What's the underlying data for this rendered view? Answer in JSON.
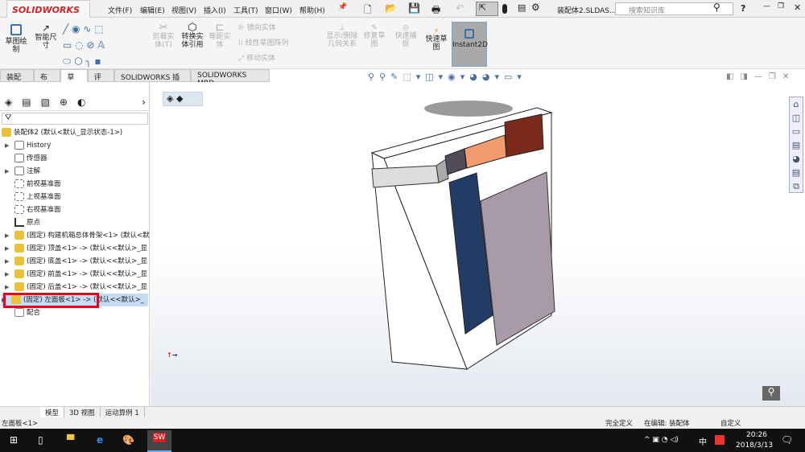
{
  "app": {
    "brand": "SOLIDWORKS",
    "document_title": "装配体2.SLDAS...",
    "search_placeholder": "搜索知识库",
    "help": "?"
  },
  "menu": [
    "文件(F)",
    "编辑(E)",
    "视图(V)",
    "插入(I)",
    "工具(T)",
    "窗口(W)",
    "帮助(H)"
  ],
  "ribbon": {
    "sketch": "草图绘制",
    "smart_dim": "智能尺寸",
    "trim": "剪裁实体(T)",
    "convert": "转换实体引用",
    "offset": "等距实体",
    "mirror": "镜向实体",
    "linear_pattern": "线性草图阵列",
    "move": "移动实体",
    "show_relations": "显示/删除几何关系",
    "repair": "修复草图",
    "quick_snap": "快速捕捉",
    "rapid_sketch": "快速草图",
    "instant2d": "Instant2D"
  },
  "tabs": [
    "装配体",
    "布局",
    "草图",
    "评估",
    "SOLIDWORKS 插件",
    "SOLIDWORKS MBD"
  ],
  "active_tab": 2,
  "tree": {
    "root": "装配体2  (默认<默认_显示状态-1>)",
    "items": [
      "History",
      "传感器",
      "注解",
      "前视基准面",
      "上视基准面",
      "右视基准面",
      "原点",
      "(固定) 构建机箱总体骨架<1> (默认<默",
      "(固定) 顶盖<1> -> (默认<<默认>_显",
      "(固定) 底盖<1> -> (默认<<默认>_显",
      "(固定) 前盖<1> -> (默认<<默认>_显",
      "(固定) 后盖<1> -> (默认<<默认>_显",
      "(固定) 左面板<1> -> (默认<<默认>_",
      "配合"
    ],
    "selected": 12
  },
  "bottom_tabs": [
    "模型",
    "3D 视图",
    "运动算例 1"
  ],
  "status": {
    "left": "左面板<1>",
    "defined": "完全定义",
    "editing": "在编辑: 装配体",
    "custom": "自定义"
  },
  "taskbar": {
    "time": "20:26",
    "date": "2018/3/13",
    "ime": "中"
  },
  "colors": {
    "highlight": "#e8001c",
    "selection": "#c5dcf2",
    "panel_blue": "#223c66",
    "panel_purple": "#a89aa6",
    "orange": "#f39a6f",
    "brown": "#7a2a1a"
  }
}
